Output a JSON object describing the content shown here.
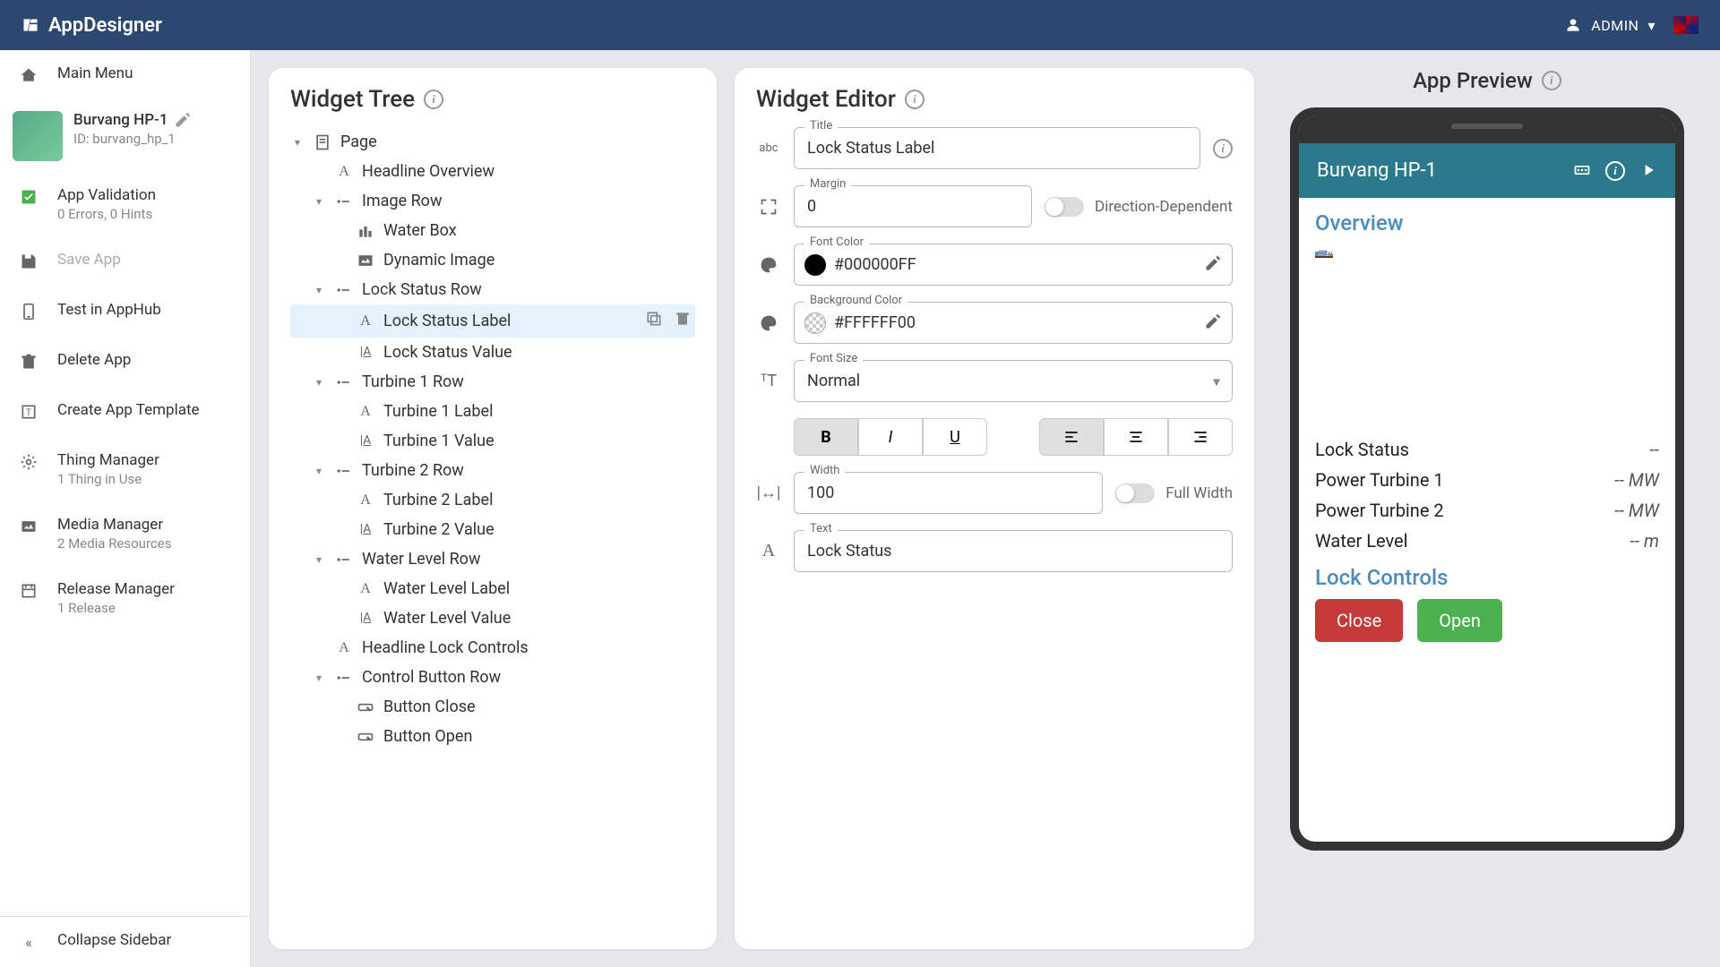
{
  "header": {
    "brand": "AppDesigner",
    "user_label": "ADMIN"
  },
  "sidebar": {
    "main_menu": "Main Menu",
    "app": {
      "name": "Burvang HP-1",
      "id_label": "ID: burvang_hp_1"
    },
    "validation": {
      "label": "App Validation",
      "sub": "0 Errors, 0 Hints"
    },
    "save": "Save App",
    "test": "Test in AppHub",
    "delete": "Delete App",
    "template": "Create App Template",
    "thing": {
      "label": "Thing Manager",
      "sub": "1 Thing in Use"
    },
    "media": {
      "label": "Media Manager",
      "sub": "2 Media Resources"
    },
    "release": {
      "label": "Release Manager",
      "sub": "1 Release"
    },
    "collapse": "Collapse Sidebar"
  },
  "tree": {
    "title": "Widget Tree",
    "nodes": [
      {
        "label": "Page",
        "icon": "page",
        "indent": 0,
        "caret": true
      },
      {
        "label": "Headline Overview",
        "icon": "text",
        "indent": 1
      },
      {
        "label": "Image Row",
        "icon": "row",
        "indent": 1,
        "caret": true
      },
      {
        "label": "Water Box",
        "icon": "bars",
        "indent": 2
      },
      {
        "label": "Dynamic Image",
        "icon": "image",
        "indent": 2
      },
      {
        "label": "Lock Status Row",
        "icon": "row",
        "indent": 1,
        "caret": true
      },
      {
        "label": "Lock Status Label",
        "icon": "text",
        "indent": 2,
        "selected": true
      },
      {
        "label": "Lock Status Value",
        "icon": "value",
        "indent": 2
      },
      {
        "label": "Turbine 1 Row",
        "icon": "row",
        "indent": 1,
        "caret": true
      },
      {
        "label": "Turbine 1 Label",
        "icon": "text",
        "indent": 2
      },
      {
        "label": "Turbine 1 Value",
        "icon": "value",
        "indent": 2
      },
      {
        "label": "Turbine 2 Row",
        "icon": "row",
        "indent": 1,
        "caret": true
      },
      {
        "label": "Turbine 2 Label",
        "icon": "text",
        "indent": 2
      },
      {
        "label": "Turbine 2 Value",
        "icon": "value",
        "indent": 2
      },
      {
        "label": "Water Level Row",
        "icon": "row",
        "indent": 1,
        "caret": true
      },
      {
        "label": "Water Level Label",
        "icon": "text",
        "indent": 2
      },
      {
        "label": "Water Level Value",
        "icon": "value",
        "indent": 2
      },
      {
        "label": "Headline Lock Controls",
        "icon": "text",
        "indent": 1
      },
      {
        "label": "Control Button Row",
        "icon": "row",
        "indent": 1,
        "caret": true
      },
      {
        "label": "Button Close",
        "icon": "button",
        "indent": 2
      },
      {
        "label": "Button Open",
        "icon": "button",
        "indent": 2
      }
    ]
  },
  "editor": {
    "title": "Widget Editor",
    "title_field": {
      "label": "Title",
      "value": "Lock Status Label"
    },
    "margin_field": {
      "label": "Margin",
      "value": "0"
    },
    "margin_toggle": "Direction-Dependent",
    "font_color": {
      "label": "Font Color",
      "value": "#000000FF",
      "swatch": "#000000"
    },
    "bg_color": {
      "label": "Background Color",
      "value": "#FFFFFF00"
    },
    "font_size": {
      "label": "Font Size",
      "value": "Normal"
    },
    "width_field": {
      "label": "Width",
      "value": "100"
    },
    "width_toggle": "Full Width",
    "text_field": {
      "label": "Text",
      "value": "Lock Status"
    }
  },
  "preview": {
    "title": "App Preview",
    "app_title": "Burvang HP-1",
    "overview": "Overview",
    "rows": [
      {
        "label": "Lock Status",
        "value": "--"
      },
      {
        "label": "Power Turbine 1",
        "value": "-- MW"
      },
      {
        "label": "Power Turbine 2",
        "value": "-- MW"
      },
      {
        "label": "Water Level",
        "value": "-- m"
      }
    ],
    "lock_controls": "Lock Controls",
    "close_btn": "Close",
    "open_btn": "Open"
  }
}
